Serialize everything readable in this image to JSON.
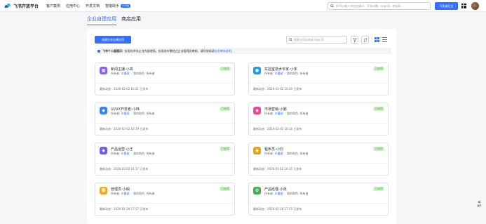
{
  "topbar": {
    "brand": "飞书开放平台",
    "nav": [
      {
        "label": "客户案例"
      },
      {
        "label": "应用中心"
      },
      {
        "label": "开发文档"
      },
      {
        "label": "智能助手",
        "badge": "AI 开发"
      }
    ],
    "search_placeholder": "你可以输入文档关键词、开发问题、Log ID、错误码",
    "console_label": "开发者后台"
  },
  "tabs": [
    {
      "label": "企业自建应用",
      "active": true
    },
    {
      "label": "商店应用",
      "active": false
    }
  ],
  "toolbar": {
    "create_label": "创建企业自建应用",
    "search_placeholder": "搜索应用名称或 App ID"
  },
  "notice": {
    "title": "飞书个人版提示:",
    "text": "应用仅供本企业内部使用。应用发布需经过企业管理员审核，请尽快阅读",
    "link": "应用审核说明。"
  },
  "apps": [
    {
      "name": "新闻主播-小高",
      "owner_label": "所有者:",
      "owner": "炎墨斌",
      "role_label": "我的角色:",
      "role": "所有者",
      "status": "已启用",
      "updated": "最新动态：2026-03-02 10:21 已发布",
      "icon": "calendar-icon",
      "color": "#8b5cf6"
    },
    {
      "name": "实验室技术专家-小宋",
      "owner_label": "所有者:",
      "owner": "炎墨斌",
      "role_label": "我的角色:",
      "role": "所有者",
      "status": "已启用",
      "updated": "最新动态：2026-03-02 10:20 已发布",
      "icon": "location-icon",
      "color": "#14a2e8"
    },
    {
      "name": "UI/UX开发者-小玮",
      "owner_label": "所有者:",
      "owner": "炎墨斌",
      "role_label": "我的角色:",
      "role": "所有者",
      "status": "已启用",
      "updated": "最新动态：2026-03-02 10:19 已发布",
      "icon": "cube-icon",
      "color": "#3b82f6"
    },
    {
      "name": "市场营销-小鄞",
      "owner_label": "所有者:",
      "owner": "炎墨斌",
      "role_label": "我的角色:",
      "role": "所有者",
      "status": "已启用",
      "updated": "最新动态：2026-03-02 10:18 已发布",
      "icon": "cube-icon",
      "color": "#ec4899"
    },
    {
      "name": "产品运营-小王",
      "owner_label": "所有者:",
      "owner": "炎墨斌",
      "role_label": "我的角色:",
      "role": "所有者",
      "status": "已启用",
      "updated": "最新动态：2026-03-02 10:17 已发布",
      "icon": "cube-icon",
      "color": "#6d5df5"
    },
    {
      "name": "程序员-小刘",
      "owner_label": "所有者:",
      "owner": "炎墨斌",
      "role_label": "我的角色:",
      "role": "所有者",
      "status": "已启用",
      "updated": "最新动态：2026-03-02 10:15 已发布",
      "icon": "cube-icon",
      "color": "#f59e0b"
    },
    {
      "name": "管理员-小帼",
      "owner_label": "所有者:",
      "owner": "炎墨斌",
      "role_label": "我的角色:",
      "role": "所有者",
      "status": "已启用",
      "updated": "最新动态：2026-02-28 17:57 已发布",
      "icon": "monkey-avatar-icon",
      "color": "#f5a623"
    },
    {
      "name": "产品经理-小张",
      "owner_label": "所有者:",
      "owner": "炎墨斌",
      "role_label": "我的角色:",
      "role": "所有者",
      "status": "已启用",
      "updated": "最新动态：2026-02-28 17:55 已发布",
      "icon": "flower-avatar-icon",
      "color": "#4caf50"
    }
  ],
  "side": {
    "collapse_label": "展开"
  }
}
